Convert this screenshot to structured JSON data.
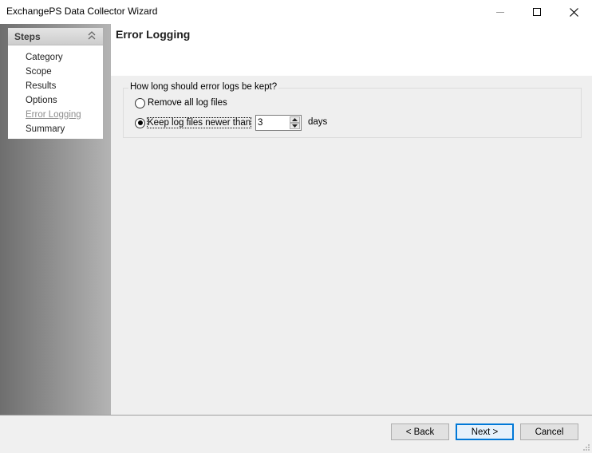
{
  "window": {
    "title": "ExchangePS Data Collector Wizard"
  },
  "sidebar": {
    "header": "Steps",
    "items": [
      {
        "label": "Category"
      },
      {
        "label": "Scope"
      },
      {
        "label": "Results"
      },
      {
        "label": "Options"
      },
      {
        "label": "Error Logging"
      },
      {
        "label": "Summary"
      }
    ],
    "active_index": 4
  },
  "page": {
    "title": "Error Logging"
  },
  "retention": {
    "question": "How long should error logs be kept?",
    "option_remove": "Remove all log files",
    "option_keep": "Keep log files newer than",
    "selected": "keep",
    "days_value": "3",
    "days_unit": "days"
  },
  "footer": {
    "back_label": "< Back",
    "next_label": "Next >",
    "cancel_label": "Cancel"
  }
}
